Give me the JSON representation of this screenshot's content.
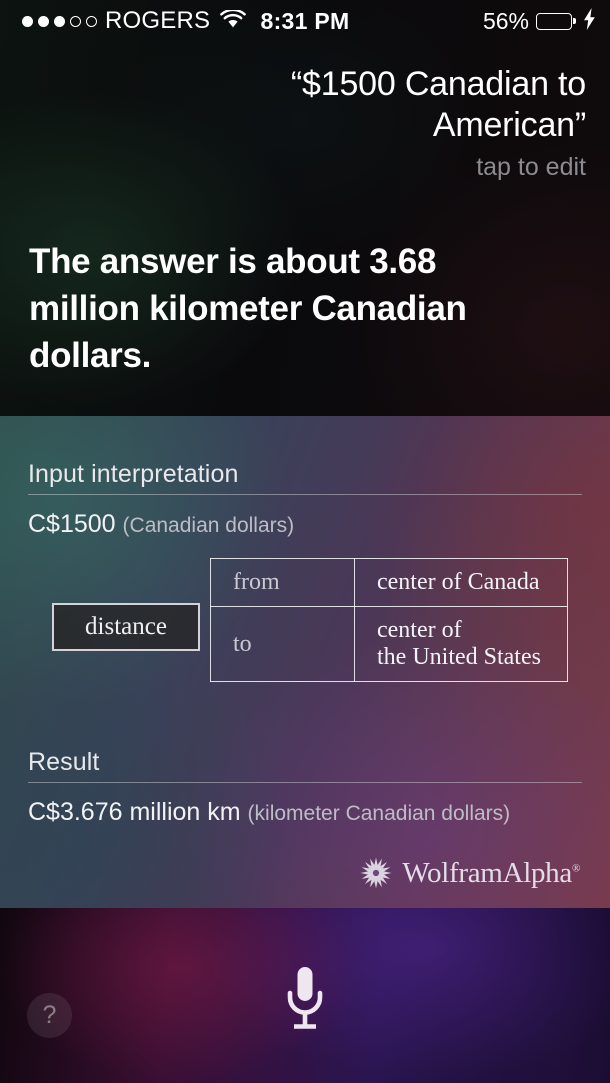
{
  "status_bar": {
    "signal_dots_filled": 3,
    "signal_dots_total": 5,
    "carrier": "ROGERS",
    "wifi_icon": "wifi-icon",
    "time": "8:31 PM",
    "battery_percent": "56%",
    "battery_level": 56,
    "battery_charging": true,
    "battery_color": "#4cd964"
  },
  "query": {
    "text": "“$1500 Canadian to American”",
    "hint": "tap to edit"
  },
  "answer": {
    "text": "The answer is about 3.68 million kilometer Canadian dollars."
  },
  "card": {
    "input_interpretation": {
      "title": "Input interpretation",
      "value": "C$1500",
      "unit": "(Canadian dollars)",
      "distance_label": "distance",
      "rows": [
        {
          "key": "from",
          "value_lines": [
            "center of Canada"
          ]
        },
        {
          "key": "to",
          "value_lines": [
            "center of",
            "the United States"
          ]
        }
      ]
    },
    "result": {
      "title": "Result",
      "value": "C$3.676 million km",
      "unit": "(kilometer Canadian dollars)"
    },
    "branding": {
      "name": "WolframAlpha",
      "trademark": "®",
      "mark_icon": "wolfram-starburst-icon"
    }
  },
  "footer": {
    "mic_icon": "microphone-icon",
    "help_label": "?"
  }
}
